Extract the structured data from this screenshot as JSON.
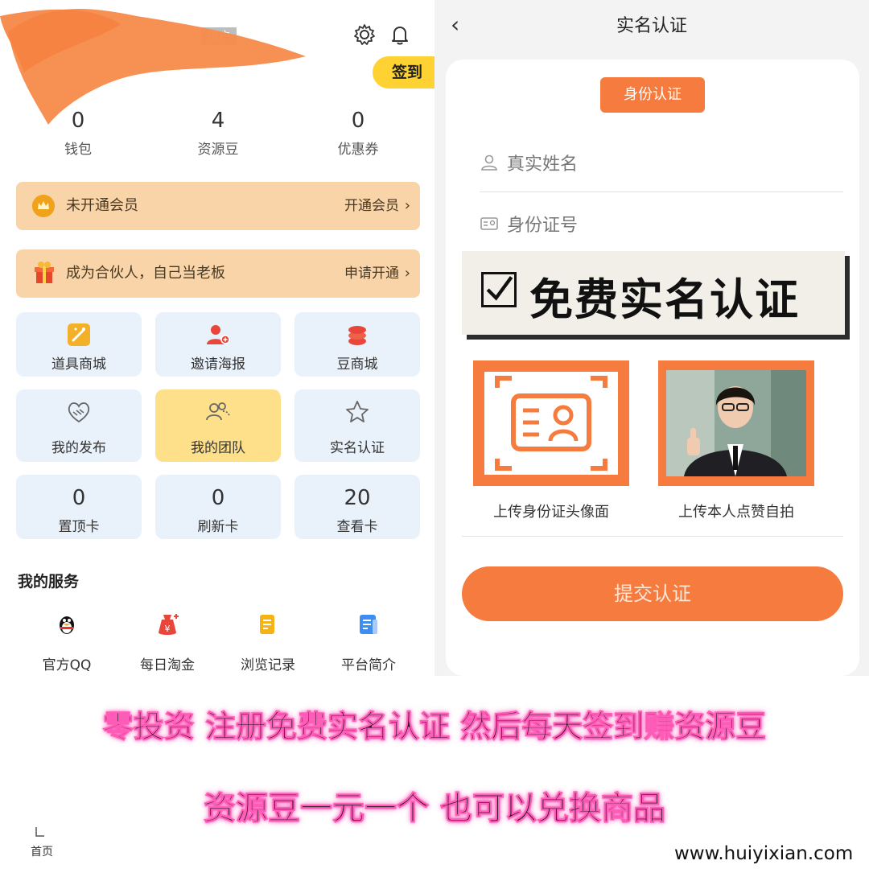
{
  "left": {
    "user_tag": "用户",
    "checkin_label": "签到",
    "stats": [
      {
        "value": "0",
        "label": "钱包"
      },
      {
        "value": "4",
        "label": "资源豆"
      },
      {
        "value": "0",
        "label": "优惠券"
      }
    ],
    "member_banner": {
      "text": "未开通会员",
      "action": "开通会员"
    },
    "partner_banner": {
      "text": "成为合伙人，自己当老板",
      "action": "申请开通"
    },
    "tiles_row1": [
      "道具商城",
      "邀请海报",
      "豆商城"
    ],
    "tiles_row2": [
      "我的发布",
      "我的团队",
      "实名认证"
    ],
    "cards": [
      {
        "value": "0",
        "label": "置顶卡"
      },
      {
        "value": "0",
        "label": "刷新卡"
      },
      {
        "value": "20",
        "label": "查看卡"
      }
    ],
    "services_title": "我的服务",
    "services": [
      "官方QQ",
      "每日淘金",
      "浏览记录",
      "平台简介"
    ],
    "nav_home": "首页"
  },
  "right": {
    "back_icon": "chevron-left-icon",
    "title": "实名认证",
    "pill": "身份认证",
    "name_placeholder": "真实姓名",
    "id_placeholder": "身份证号",
    "promo_text": "免费实名认证",
    "upload_id_label": "上传身份证头像面",
    "upload_selfie_label": "上传本人点赞自拍",
    "submit_label": "提交认证"
  },
  "caption": {
    "line1": "零投资 注册免费实名认证 然后每天签到赚资源豆",
    "line2": "资源豆一元一个 也可以兑换商品"
  },
  "website": "www.huiyixian.com",
  "colors": {
    "accent": "#f57b3e",
    "checkin": "#ffd233",
    "banner": "#f8d4a8",
    "tile": "#e9f1fb",
    "caption_glow": "#ff5cb8"
  }
}
